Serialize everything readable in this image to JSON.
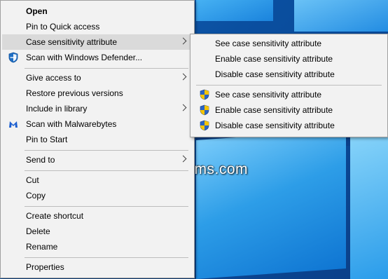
{
  "context_menu": {
    "open": "Open",
    "pin_quick_access": "Pin to Quick access",
    "case_sensitivity": "Case sensitivity attribute",
    "scan_defender": "Scan with Windows Defender...",
    "give_access": "Give access to",
    "restore_versions": "Restore previous versions",
    "include_library": "Include in library",
    "scan_malwarebytes": "Scan with Malwarebytes",
    "pin_start": "Pin to Start",
    "send_to": "Send to",
    "cut": "Cut",
    "copy": "Copy",
    "create_shortcut": "Create shortcut",
    "delete": "Delete",
    "rename": "Rename",
    "properties": "Properties"
  },
  "submenu": {
    "see": "See case sensitivity attribute",
    "enable": "Enable case sensitivity attribute",
    "disable": "Disable case sensitivity attribute",
    "see_admin": "See case sensitivity attribute",
    "enable_admin": "Enable case sensitivity attribute",
    "disable_admin": "Disable case sensitivity attribute"
  },
  "watermark": "TenForums.com",
  "icons": {
    "defender": "windows-defender-icon",
    "malwarebytes": "malwarebytes-icon",
    "uac": "uac-shield-icon"
  },
  "colors": {
    "menu_bg": "#f2f2f2",
    "highlight": "#dadada",
    "desktop": "#0b4fa0"
  }
}
